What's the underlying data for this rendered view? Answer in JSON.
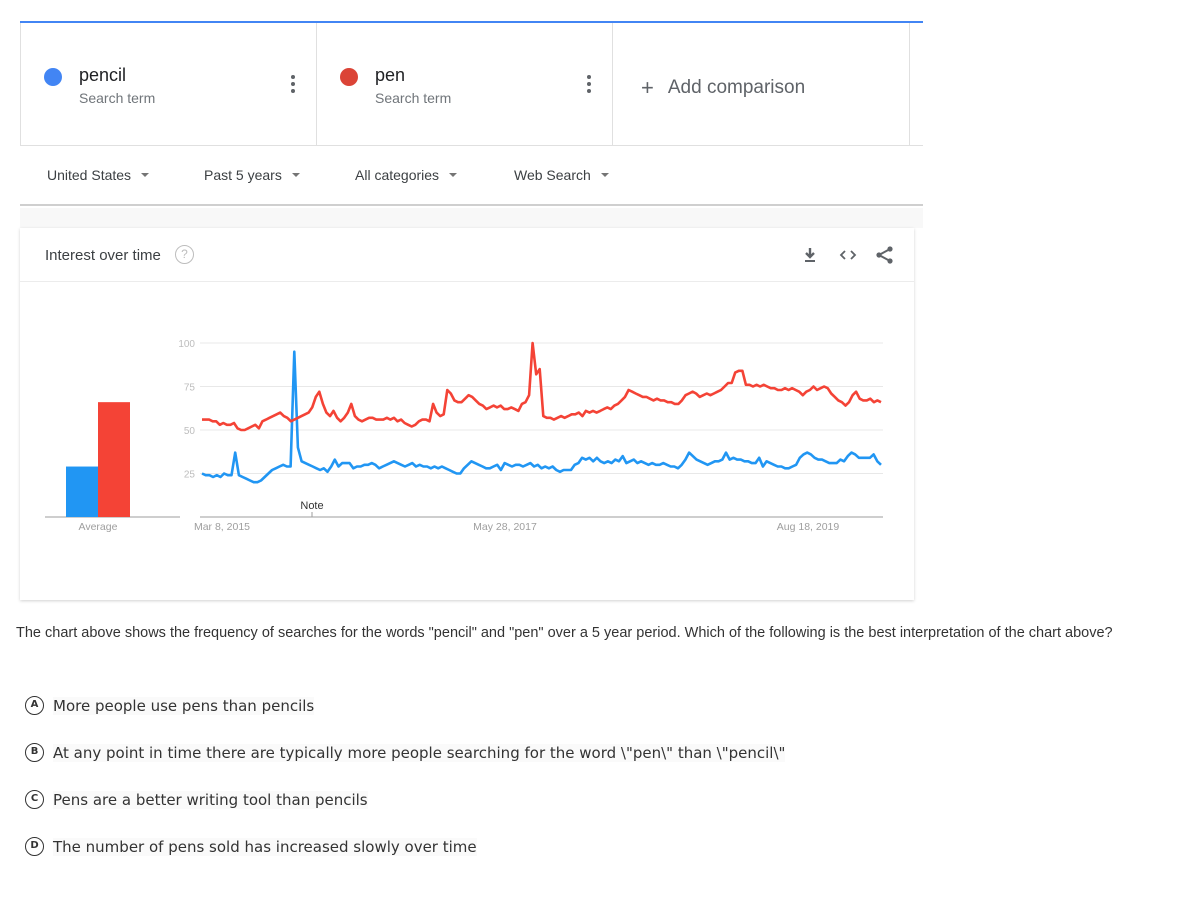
{
  "terms": [
    {
      "name": "pencil",
      "subtitle": "Search term",
      "color": "#4285f4"
    },
    {
      "name": "pen",
      "subtitle": "Search term",
      "color": "#db4437"
    }
  ],
  "add_comparison": {
    "icon": "plus-icon",
    "label": "Add comparison"
  },
  "filters": [
    {
      "label": "United States"
    },
    {
      "label": "Past 5 years"
    },
    {
      "label": "All categories"
    },
    {
      "label": "Web Search"
    }
  ],
  "card": {
    "title": "Interest over time",
    "help_icon": "?",
    "tools": [
      "download-icon",
      "embed-icon",
      "share-icon"
    ]
  },
  "chart_data": {
    "type": "line",
    "title": "Interest over time",
    "xlabel": "",
    "ylabel": "",
    "ylim": [
      0,
      100
    ],
    "yticks": [
      25,
      50,
      75,
      100
    ],
    "xtick_labels": [
      "Mar 8, 2015",
      "May 28, 2017",
      "Aug 18, 2019"
    ],
    "annotation": "Note",
    "grid": true,
    "averages": {
      "label": "Average",
      "series": [
        {
          "name": "pencil",
          "value": 29,
          "color": "#2196f3"
        },
        {
          "name": "pen",
          "value": 66,
          "color": "#f44336"
        }
      ]
    },
    "series": [
      {
        "name": "pencil",
        "color": "#2196f3",
        "values": [
          25,
          24,
          24,
          23,
          24,
          23,
          25,
          24,
          24,
          37,
          24,
          23,
          22,
          21,
          20,
          20,
          21,
          23,
          25,
          27,
          28,
          29,
          30,
          29,
          29,
          95,
          40,
          32,
          31,
          30,
          29,
          28,
          27,
          28,
          26,
          29,
          33,
          29,
          31,
          31,
          31,
          28,
          29,
          29,
          30,
          30,
          31,
          30,
          28,
          29,
          30,
          31,
          32,
          31,
          30,
          29,
          30,
          31,
          29,
          30,
          29,
          29,
          28,
          29,
          28,
          29,
          28,
          27,
          26,
          25,
          25,
          28,
          30,
          32,
          31,
          30,
          29,
          28,
          28,
          29,
          30,
          27,
          31,
          30,
          29,
          30,
          30,
          29,
          30,
          31,
          29,
          30,
          28,
          29,
          28,
          29,
          27,
          26,
          27,
          27,
          27,
          30,
          31,
          34,
          33,
          34,
          32,
          34,
          32,
          31,
          32,
          31,
          33,
          32,
          35,
          31,
          32,
          33,
          31,
          32,
          31,
          30,
          31,
          30,
          30,
          31,
          30,
          29,
          29,
          28,
          30,
          33,
          37,
          35,
          33,
          32,
          31,
          30,
          31,
          32,
          32,
          33,
          37,
          33,
          34,
          33,
          33,
          32,
          32,
          31,
          31,
          34,
          29,
          32,
          31,
          30,
          29,
          29,
          28,
          28,
          29,
          30,
          34,
          36,
          37,
          36,
          34,
          33,
          33,
          32,
          31,
          31,
          31,
          33,
          32,
          35,
          37,
          36,
          34,
          34,
          34,
          34,
          36,
          32,
          30
        ]
      },
      {
        "name": "pen",
        "color": "#f44336",
        "values": [
          56,
          56,
          56,
          55,
          55,
          53,
          54,
          53,
          53,
          54,
          51,
          50,
          50,
          51,
          52,
          53,
          51,
          55,
          56,
          57,
          58,
          59,
          60,
          58,
          57,
          55,
          56,
          57,
          58,
          59,
          60,
          63,
          69,
          72,
          65,
          60,
          58,
          61,
          57,
          55,
          57,
          60,
          65,
          58,
          56,
          55,
          56,
          57,
          57,
          56,
          56,
          56,
          57,
          56,
          57,
          55,
          56,
          54,
          53,
          52,
          53,
          55,
          56,
          56,
          55,
          65,
          60,
          58,
          59,
          73,
          71,
          67,
          66,
          66,
          68,
          70,
          69,
          67,
          65,
          64,
          62,
          63,
          64,
          63,
          64,
          62,
          62,
          63,
          62,
          61,
          65,
          66,
          70,
          100,
          82,
          85,
          58,
          57,
          57,
          56,
          57,
          58,
          57,
          58,
          59,
          59,
          60,
          58,
          61,
          60,
          61,
          60,
          61,
          62,
          63,
          62,
          64,
          65,
          67,
          69,
          73,
          72,
          71,
          70,
          69,
          69,
          68,
          67,
          68,
          67,
          67,
          66,
          66,
          65,
          65,
          67,
          70,
          71,
          72,
          71,
          69,
          70,
          71,
          70,
          71,
          72,
          73,
          75,
          77,
          77,
          83,
          84,
          84,
          76,
          76,
          75,
          76,
          75,
          76,
          75,
          74,
          74,
          73,
          73,
          74,
          73,
          74,
          73,
          72,
          70,
          72,
          73,
          75,
          73,
          74,
          75,
          74,
          71,
          69,
          67,
          66,
          64,
          66,
          70,
          72,
          68,
          67,
          67,
          68,
          66,
          67,
          66
        ]
      }
    ]
  },
  "question": "The chart above shows the frequency of searches for the words \"pencil\" and \"pen\" over a 5 year period. Which of the following is the best interpretation of the chart above?",
  "options": [
    {
      "letter": "A",
      "text": "More people use pens than pencils"
    },
    {
      "letter": "B",
      "text": "At any point in time there are typically more people searching for the word \\\"pen\\\" than \\\"pencil\\\""
    },
    {
      "letter": "C",
      "text": "Pens are a better writing tool than pencils"
    },
    {
      "letter": "D",
      "text": "The number of pens sold has increased slowly over time"
    }
  ]
}
